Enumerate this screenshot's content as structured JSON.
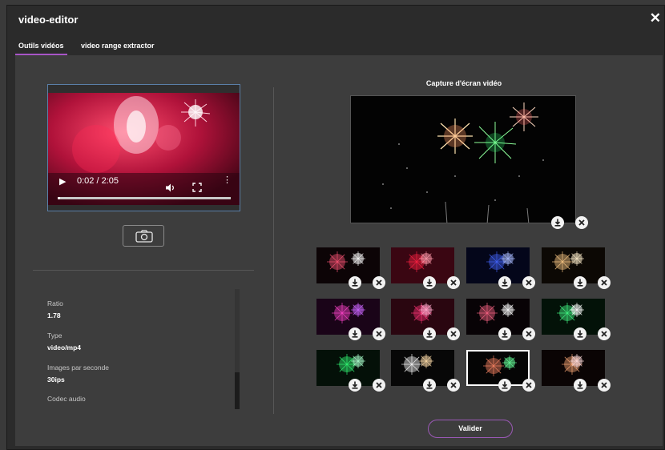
{
  "dialog": {
    "title": "video-editor"
  },
  "tabs": [
    {
      "label": "Outils vidéos",
      "active": true
    },
    {
      "label": "video range extractor",
      "active": false
    }
  ],
  "player": {
    "time": "0:02 / 2:05",
    "progress_fraction": 0.016,
    "icons": [
      "play-icon",
      "volume-icon",
      "fullscreen-icon",
      "more-options-icon"
    ]
  },
  "screenshot_button": {
    "icon": "camera-icon"
  },
  "video_info": [
    {
      "label": "Ratio",
      "value": "1.78"
    },
    {
      "label": "Type",
      "value": "video/mp4"
    },
    {
      "label": "Images par seconde",
      "value": "30ips"
    },
    {
      "label": "Codec audio",
      "value": ""
    }
  ],
  "capture": {
    "title": "Capture d'écran vidéo",
    "thumbnails": [
      {
        "palette": [
          "#ff5577",
          "#ffffff"
        ],
        "bg": "#0c0406",
        "selected": false
      },
      {
        "palette": [
          "#ff2244",
          "#ff99aa"
        ],
        "bg": "#3a0612",
        "selected": false
      },
      {
        "palette": [
          "#4466ff",
          "#aabbff"
        ],
        "bg": "#04061a",
        "selected": false
      },
      {
        "palette": [
          "#ffcc88",
          "#ffeecc"
        ],
        "bg": "#0c0804",
        "selected": false
      },
      {
        "palette": [
          "#ff44cc",
          "#cc66ff"
        ],
        "bg": "#1a0418",
        "selected": false
      },
      {
        "palette": [
          "#ff3377",
          "#ffaacc"
        ],
        "bg": "#2a0610",
        "selected": false
      },
      {
        "palette": [
          "#ff6688",
          "#ffffff"
        ],
        "bg": "#080306",
        "selected": false
      },
      {
        "palette": [
          "#44ff88",
          "#ffffff"
        ],
        "bg": "#031208",
        "selected": false
      },
      {
        "palette": [
          "#33ff77",
          "#aaffcc"
        ],
        "bg": "#041008",
        "selected": false
      },
      {
        "palette": [
          "#ffffff",
          "#ffddaa"
        ],
        "bg": "#070707",
        "selected": false
      },
      {
        "palette": [
          "#ff8866",
          "#66ff99"
        ],
        "bg": "#050505",
        "selected": true
      },
      {
        "palette": [
          "#ffaa77",
          "#ffdddd"
        ],
        "bg": "#0a0404",
        "selected": false
      }
    ]
  },
  "actions": {
    "validate_label": "Valider"
  },
  "colors": {
    "accent": "#a855c7",
    "panel": "#3d3d3d",
    "dialog": "#2b2b2b"
  }
}
